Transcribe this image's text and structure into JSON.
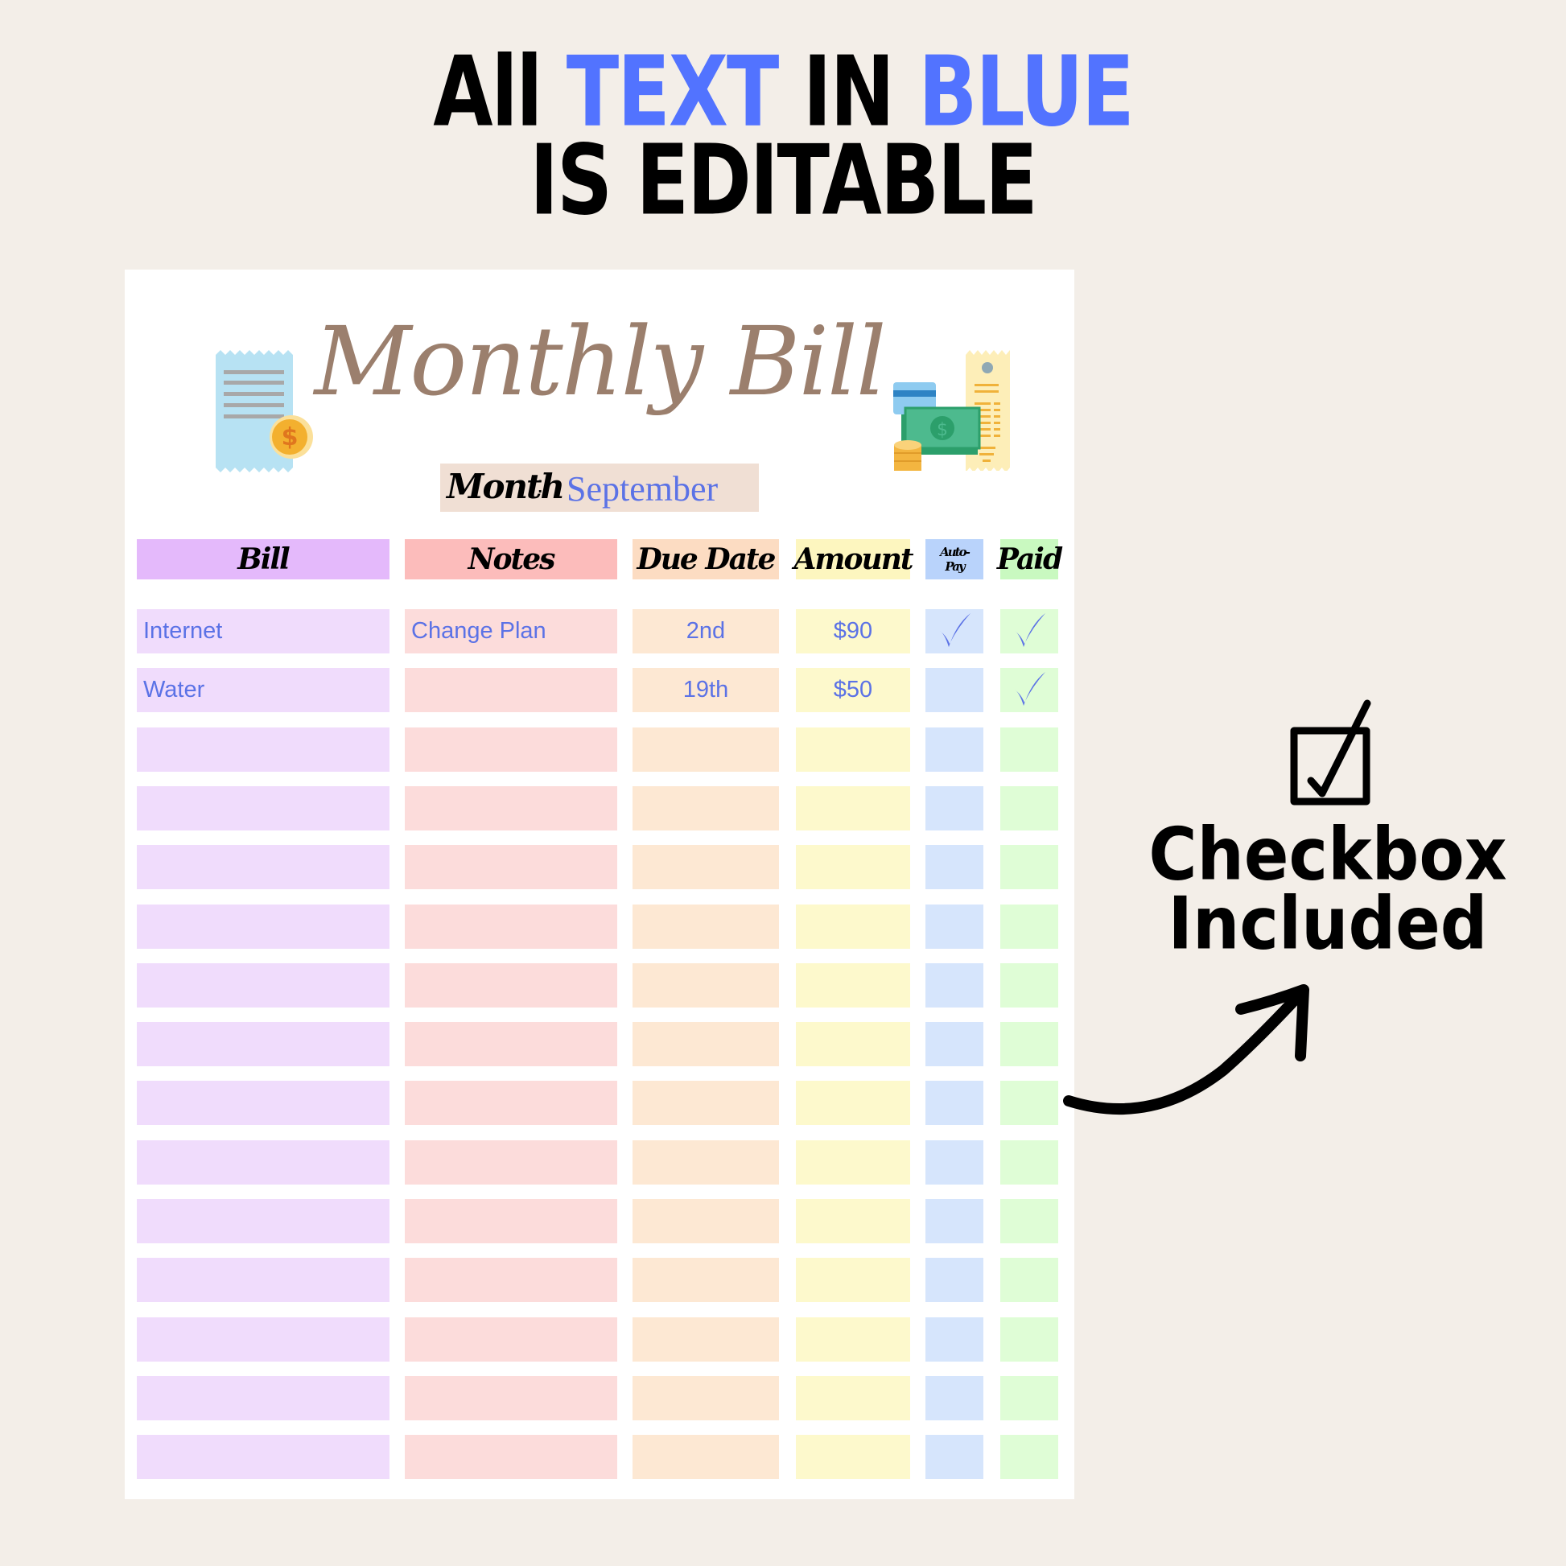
{
  "headline": {
    "line1_parts": [
      {
        "text": "All ",
        "color": "#000000"
      },
      {
        "text": "TEXT",
        "color": "#5273ff"
      },
      {
        "text": " IN ",
        "color": "#000000"
      },
      {
        "text": "BLUE",
        "color": "#5273ff"
      }
    ],
    "line2": "IS EDITABLE"
  },
  "sheet": {
    "title": "Monthly Bill",
    "month_label": "Month",
    "month_separator": ":",
    "month_value": "September",
    "columns": [
      {
        "key": "bill",
        "label": "Bill",
        "color": "#e4b9fb"
      },
      {
        "key": "notes",
        "label": "Notes",
        "color": "#fcbcbb"
      },
      {
        "key": "due_date",
        "label": "Due Date",
        "color": "#fcdcc2"
      },
      {
        "key": "amount",
        "label": "Amount",
        "color": "#fdf6bf"
      },
      {
        "key": "auto_pay",
        "label": "Auto-Pay",
        "label_lines": [
          "Auto-",
          "Pay"
        ],
        "color": "#b9d3fb"
      },
      {
        "key": "paid",
        "label": "Paid",
        "color": "#c9f9c0"
      }
    ],
    "row_colors": [
      "#f0dcfc",
      "#fcdcdb",
      "#fde8d3",
      "#fdf9cc",
      "#d6e5fc",
      "#dffdd6"
    ],
    "text_color": "#5b72e6",
    "rows": [
      {
        "bill": "Internet",
        "notes": "Change Plan",
        "due_date": "2nd",
        "amount": "$90",
        "auto_pay": true,
        "paid": true
      },
      {
        "bill": "Water",
        "notes": "",
        "due_date": "19th",
        "amount": "$50",
        "auto_pay": false,
        "paid": true
      },
      {
        "bill": "",
        "notes": "",
        "due_date": "",
        "amount": "",
        "auto_pay": false,
        "paid": false
      },
      {
        "bill": "",
        "notes": "",
        "due_date": "",
        "amount": "",
        "auto_pay": false,
        "paid": false
      },
      {
        "bill": "",
        "notes": "",
        "due_date": "",
        "amount": "",
        "auto_pay": false,
        "paid": false
      },
      {
        "bill": "",
        "notes": "",
        "due_date": "",
        "amount": "",
        "auto_pay": false,
        "paid": false
      },
      {
        "bill": "",
        "notes": "",
        "due_date": "",
        "amount": "",
        "auto_pay": false,
        "paid": false
      },
      {
        "bill": "",
        "notes": "",
        "due_date": "",
        "amount": "",
        "auto_pay": false,
        "paid": false
      },
      {
        "bill": "",
        "notes": "",
        "due_date": "",
        "amount": "",
        "auto_pay": false,
        "paid": false
      },
      {
        "bill": "",
        "notes": "",
        "due_date": "",
        "amount": "",
        "auto_pay": false,
        "paid": false
      },
      {
        "bill": "",
        "notes": "",
        "due_date": "",
        "amount": "",
        "auto_pay": false,
        "paid": false
      },
      {
        "bill": "",
        "notes": "",
        "due_date": "",
        "amount": "",
        "auto_pay": false,
        "paid": false
      },
      {
        "bill": "",
        "notes": "",
        "due_date": "",
        "amount": "",
        "auto_pay": false,
        "paid": false
      },
      {
        "bill": "",
        "notes": "",
        "due_date": "",
        "amount": "",
        "auto_pay": false,
        "paid": false
      },
      {
        "bill": "",
        "notes": "",
        "due_date": "",
        "amount": "",
        "auto_pay": false,
        "paid": false
      }
    ],
    "icons": [
      "receipt-coin-icon",
      "money-cards-receipt-icon"
    ]
  },
  "annotation": {
    "icon": "checkbox-checked-icon",
    "line1": "Checkbox",
    "line2": "Included",
    "arrow": "curved-arrow-icon"
  }
}
